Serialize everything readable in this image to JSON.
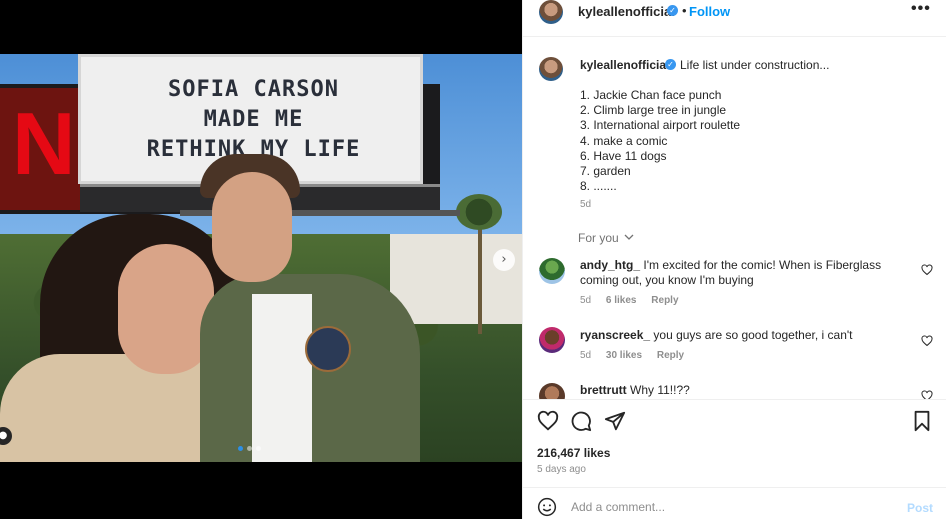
{
  "header": {
    "username": "kyleallenofficial",
    "separator": "•",
    "follow_label": "Follow",
    "more_label": "•••"
  },
  "media": {
    "billboard_lines": [
      "SOFIA CARSON",
      "MADE ME",
      "RETHINK MY LIFE"
    ],
    "logo_letter": "N",
    "next_glyph": "›",
    "carousel_dots": 3,
    "carousel_active_index": 0
  },
  "caption": {
    "username": "kyleallenofficial",
    "text": "Life list under construction...",
    "list": [
      "1. Jackie Chan face punch",
      "2. Climb large tree in jungle",
      "3. International airport roulette",
      "4. make a comic",
      "6. Have 11 dogs",
      "7. garden",
      "8. ......."
    ],
    "time": "5d"
  },
  "for_you_label": "For you",
  "comments": [
    {
      "username": "andy_htg_",
      "text": "I'm excited for the comic! When is Fiberglass coming out, you know I'm buying",
      "time": "5d",
      "likes": "6 likes",
      "reply": "Reply"
    },
    {
      "username": "ryanscreek_",
      "text": "you guys are so good together, i can't",
      "time": "5d",
      "likes": "30 likes",
      "reply": "Reply"
    },
    {
      "username": "brettrutt",
      "text": "Why 11!!??"
    }
  ],
  "engagement": {
    "likes": "216,467 likes",
    "posted": "5 days ago"
  },
  "add_comment": {
    "placeholder": "Add a comment...",
    "post_label": "Post"
  },
  "colors": {
    "accent": "#0095f6",
    "verified": "#3897f0",
    "muted": "#8e8e8e",
    "post_disabled": "#b3dbff"
  }
}
